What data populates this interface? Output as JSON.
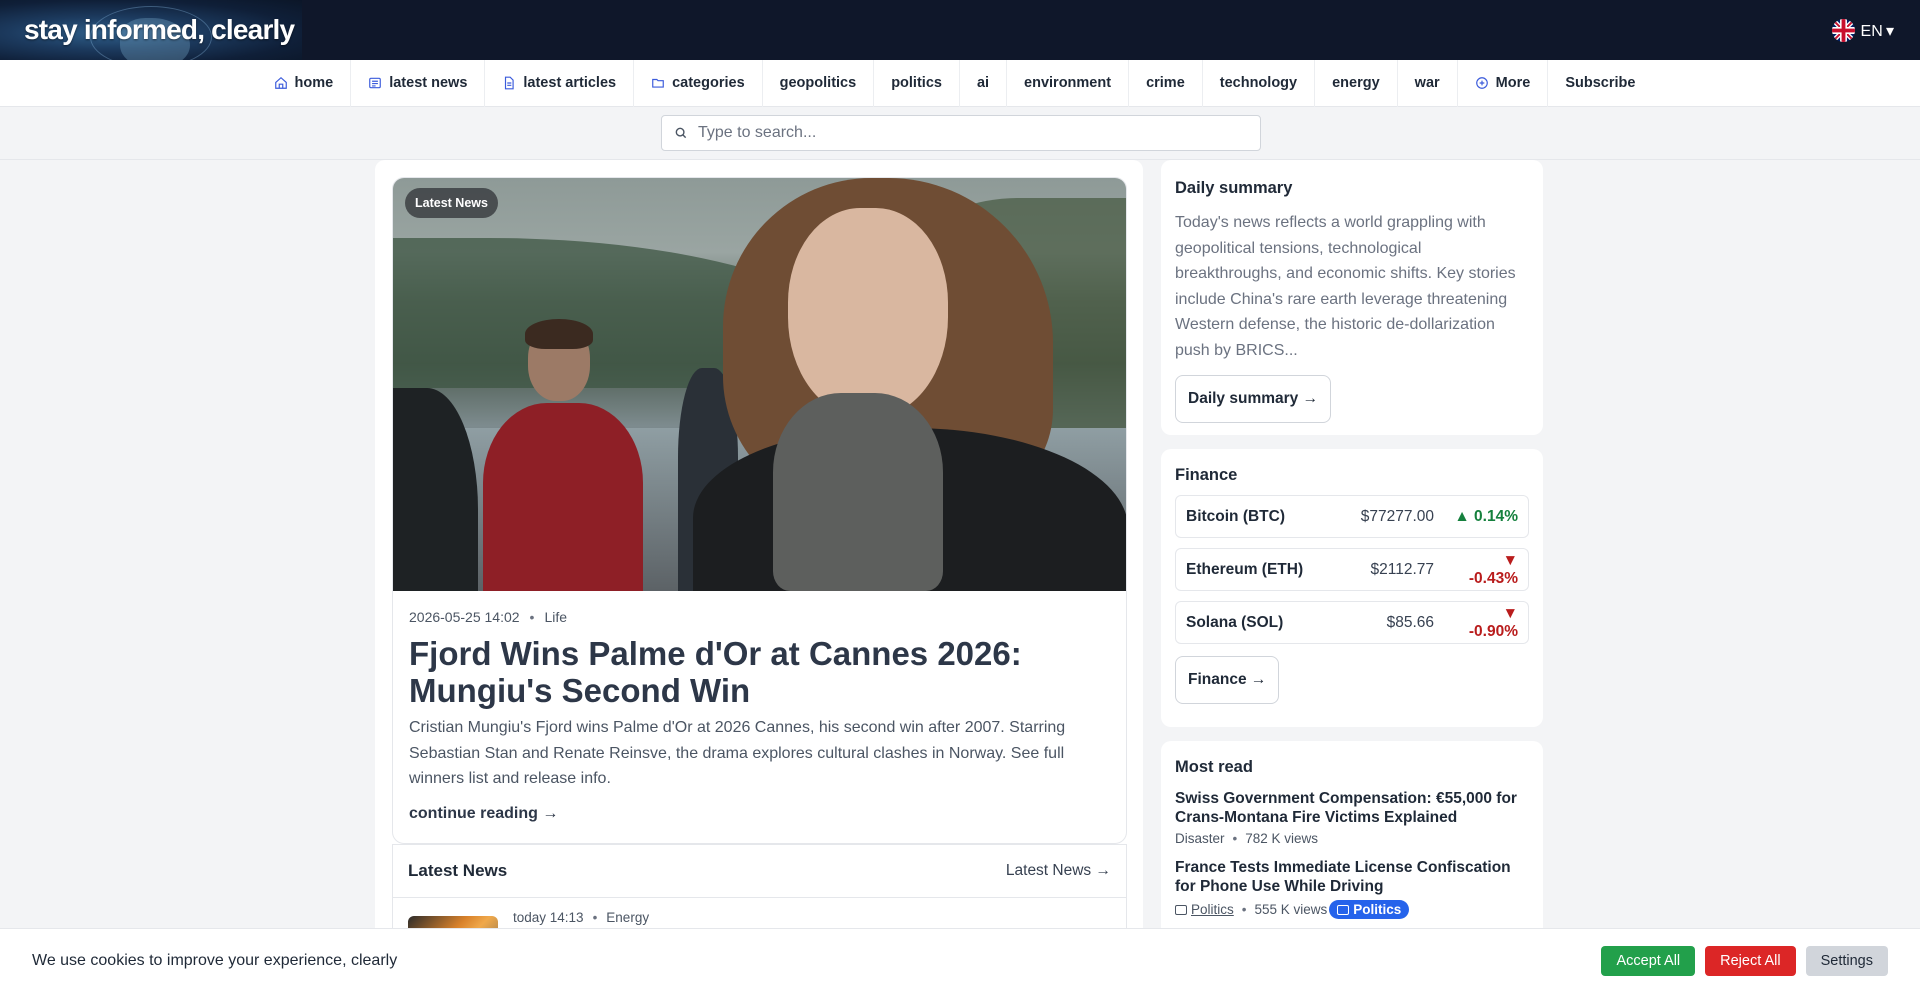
{
  "header": {
    "logo_text": "stay informed, clearly",
    "language": "EN ▾"
  },
  "nav": [
    {
      "label": "home",
      "icon": "home-icon"
    },
    {
      "label": "latest news",
      "icon": "newspaper-icon"
    },
    {
      "label": "latest articles",
      "icon": "document-icon"
    },
    {
      "label": "categories",
      "icon": "folder-icon"
    },
    {
      "label": "geopolitics"
    },
    {
      "label": "politics"
    },
    {
      "label": "ai"
    },
    {
      "label": "environment"
    },
    {
      "label": "crime"
    },
    {
      "label": "technology"
    },
    {
      "label": "energy"
    },
    {
      "label": "war"
    },
    {
      "label": "More",
      "icon": "plus-circle-icon"
    },
    {
      "label": "Subscribe"
    }
  ],
  "search": {
    "placeholder": "Type to search..."
  },
  "feature": {
    "badge": "Latest News",
    "date": "2026-05-25 14:02",
    "category": "Life",
    "title": "Fjord Wins Palme d'Or at Cannes 2026: Mungiu's Second Win",
    "description": "Cristian Mungiu's Fjord wins Palme d'Or at 2026 Cannes, his second win after 2007. Starring Sebastian Stan and Renate Reinsve, the drama explores cultural clashes in Norway. See full winners list and release info.",
    "continue_label": "continue reading →"
  },
  "latest_news": {
    "title": "Latest News",
    "link_label": "Latest News →",
    "first_item": {
      "time": "today 14:13",
      "category": "Energy"
    }
  },
  "daily_summary": {
    "title": "Daily summary",
    "text": "Today's news reflects a world grappling with geopolitical tensions, technological breakthroughs, and economic shifts. Key stories include China's rare earth leverage threatening Western defense, the historic de-dollarization push by BRICS...",
    "button": "Daily summary →"
  },
  "finance": {
    "title": "Finance",
    "coins": [
      {
        "name": "Bitcoin (BTC)",
        "price": "$77277.00",
        "change": "▲ 0.14%",
        "direction": "up"
      },
      {
        "name": "Ethereum (ETH)",
        "price": "$2112.77",
        "change": "▼ -0.43%",
        "direction": "down"
      },
      {
        "name": "Solana (SOL)",
        "price": "$85.66",
        "change": "▼ -0.90%",
        "direction": "down"
      }
    ],
    "button": "Finance →"
  },
  "most_read": {
    "title": "Most read",
    "items": [
      {
        "title": "Swiss Government Compensation: €55,000 for Crans-Montana Fire Victims Explained",
        "category": "Disaster",
        "views": "782 K views"
      },
      {
        "title": "France Tests Immediate License Confiscation for Phone Use While Driving",
        "category": "Politics",
        "views": "555 K views",
        "chip": "Politics"
      }
    ]
  },
  "cookie": {
    "text": "We use cookies to improve your experience, clearly",
    "accept": "Accept All",
    "reject": "Reject All",
    "settings": "Settings"
  },
  "colors": {
    "topbar": "#0f172a",
    "accent_blue": "#2563eb",
    "up_green": "#15803d",
    "down_red": "#b91c1c",
    "accept_green": "#22a04b",
    "reject_red": "#dc2626"
  }
}
